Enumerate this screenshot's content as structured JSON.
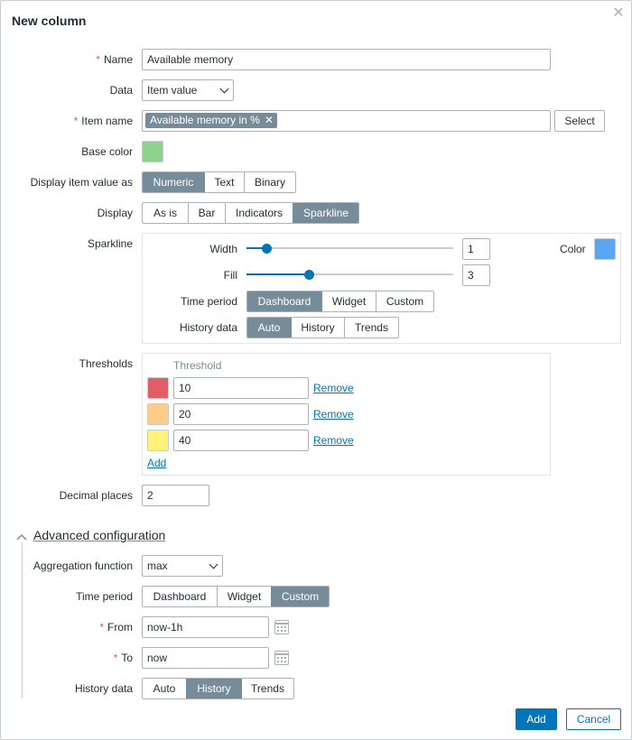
{
  "dialog": {
    "title": "New column",
    "close_icon": "close-icon"
  },
  "form": {
    "name": {
      "label": "Name",
      "value": "Available memory"
    },
    "data": {
      "label": "Data",
      "value": "Item value"
    },
    "item_name": {
      "label": "Item name",
      "tag": "Available memory in %",
      "select_label": "Select"
    },
    "base_color": {
      "label": "Base color",
      "color": "#8fd18f"
    },
    "display_as": {
      "label": "Display item value as",
      "options": [
        "Numeric",
        "Text",
        "Binary"
      ],
      "selected": "Numeric"
    },
    "display": {
      "label": "Display",
      "options": [
        "As is",
        "Bar",
        "Indicators",
        "Sparkline"
      ],
      "selected": "Sparkline"
    },
    "sparkline": {
      "label": "Sparkline",
      "width": {
        "label": "Width",
        "value": "1"
      },
      "fill": {
        "label": "Fill",
        "value": "3"
      },
      "color": {
        "label": "Color",
        "value": "#5aa6f5"
      },
      "time_period": {
        "label": "Time period",
        "options": [
          "Dashboard",
          "Widget",
          "Custom"
        ],
        "selected": "Dashboard"
      },
      "history_data": {
        "label": "History data",
        "options": [
          "Auto",
          "History",
          "Trends"
        ],
        "selected": "Auto"
      }
    },
    "thresholds": {
      "label": "Thresholds",
      "header": "Threshold",
      "rows": [
        {
          "color": "#e15f64",
          "value": "10",
          "remove": "Remove"
        },
        {
          "color": "#ffcb88",
          "value": "20",
          "remove": "Remove"
        },
        {
          "color": "#fff27a",
          "value": "40",
          "remove": "Remove"
        }
      ],
      "add_label": "Add"
    },
    "decimal_places": {
      "label": "Decimal places",
      "value": "2"
    }
  },
  "advanced": {
    "title": "Advanced configuration",
    "aggregation": {
      "label": "Aggregation function",
      "value": "max"
    },
    "time_period": {
      "label": "Time period",
      "options": [
        "Dashboard",
        "Widget",
        "Custom"
      ],
      "selected": "Custom"
    },
    "from": {
      "label": "From",
      "value": "now-1h"
    },
    "to": {
      "label": "To",
      "value": "now"
    },
    "history_data": {
      "label": "History data",
      "options": [
        "Auto",
        "History",
        "Trends"
      ],
      "selected": "History"
    }
  },
  "footer": {
    "add_label": "Add",
    "cancel_label": "Cancel"
  }
}
